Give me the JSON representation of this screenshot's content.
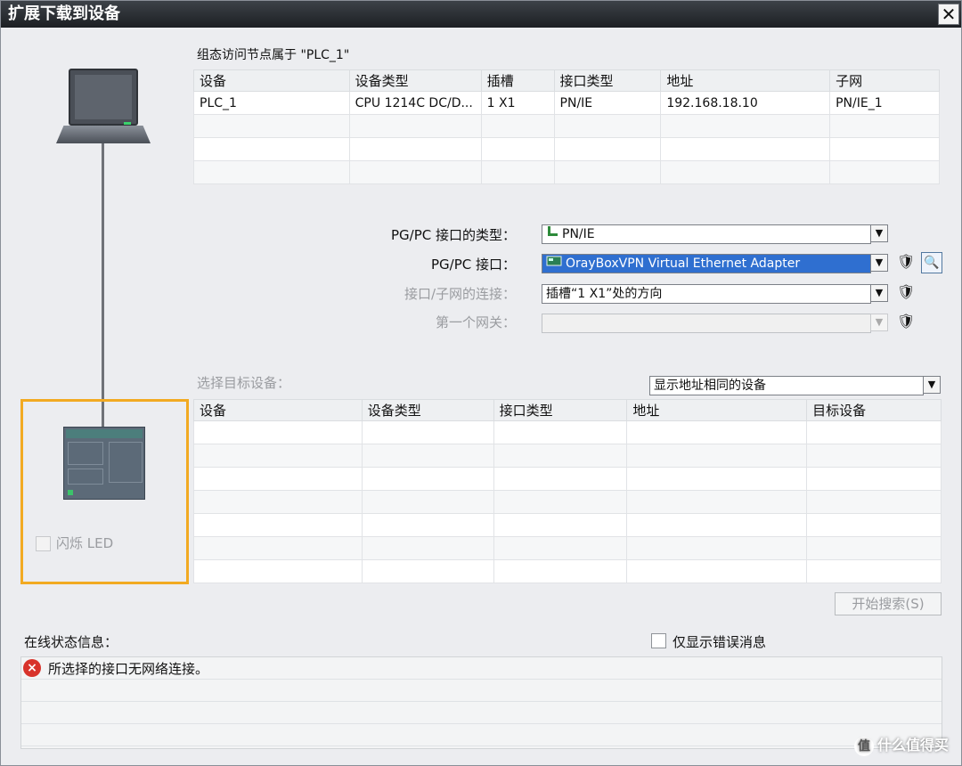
{
  "window": {
    "title": "扩展下载到设备",
    "close_glyph": "✕"
  },
  "config_section": {
    "heading": "组态访问节点属于 \"PLC_1\"",
    "columns": [
      "设备",
      "设备类型",
      "插槽",
      "接口类型",
      "地址",
      "子网"
    ],
    "rows": [
      [
        "PLC_1",
        "CPU 1214C DC/D...",
        "1 X1",
        "PN/IE",
        "192.168.18.10",
        "PN/IE_1"
      ],
      [
        "",
        "",
        "",
        "",
        "",
        ""
      ],
      [
        "",
        "",
        "",
        "",
        "",
        ""
      ],
      [
        "",
        "",
        "",
        "",
        "",
        ""
      ]
    ]
  },
  "interface": {
    "type_label": "PG/PC 接口的类型：",
    "type_value": "PN/IE",
    "pgpc_label": "PG/PC 接口：",
    "pgpc_value": "OrayBoxVPN Virtual Ethernet Adapter",
    "subnet_label": "接口/子网的连接：",
    "subnet_value": "插槽“1 X1”处的方向",
    "gateway_label": "第一个网关：",
    "gateway_value": ""
  },
  "target_section": {
    "heading": "选择目标设备：",
    "filter_value": "显示地址相同的设备",
    "columns": [
      "设备",
      "设备类型",
      "接口类型",
      "地址",
      "目标设备"
    ],
    "rows": [
      [
        "",
        "",
        "",
        "",
        ""
      ],
      [
        "",
        "",
        "",
        "",
        ""
      ],
      [
        "",
        "",
        "",
        "",
        ""
      ],
      [
        "",
        "",
        "",
        "",
        ""
      ],
      [
        "",
        "",
        "",
        "",
        ""
      ],
      [
        "",
        "",
        "",
        "",
        ""
      ],
      [
        "",
        "",
        "",
        "",
        ""
      ]
    ]
  },
  "flash_led_label": "闪烁 LED",
  "search_button_label": "开始搜索(S)",
  "status": {
    "heading": "在线状态信息：",
    "errors_only_label": "仅显示错误消息",
    "messages": [
      "所选择的接口无网络连接。"
    ]
  },
  "watermark": "什么值得买",
  "colors": {
    "accent_selection": "#2f6fd0",
    "highlight_box": "#f2aa22",
    "error": "#d8332b"
  }
}
